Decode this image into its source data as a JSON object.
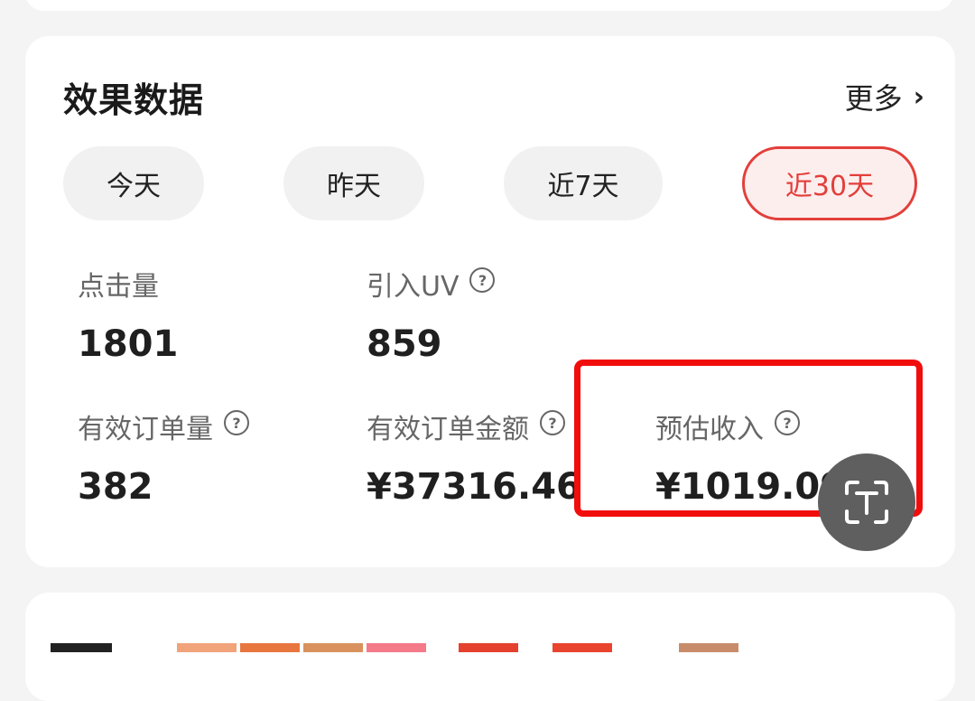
{
  "section": {
    "title": "效果数据",
    "more_label": "更多"
  },
  "tabs": [
    {
      "label": "今天",
      "active": false
    },
    {
      "label": "昨天",
      "active": false
    },
    {
      "label": "近7天",
      "active": false
    },
    {
      "label": "近30天",
      "active": true
    }
  ],
  "metrics": {
    "clicks": {
      "label": "点击量",
      "value": "1801"
    },
    "uv": {
      "label": "引入UV",
      "value": "859"
    },
    "orders": {
      "label": "有效订单量",
      "value": "382"
    },
    "order_amount": {
      "label": "有效订单金额",
      "value": "¥37316.46"
    },
    "income": {
      "label": "预估收入",
      "value": "¥1019.09"
    }
  },
  "colors": {
    "accent": "#e33f3a",
    "highlight_box": "#f20d0d",
    "card_bg": "#ffffff",
    "page_bg": "#f4f4f4"
  },
  "icons": {
    "more": "chevron-right-icon",
    "help": "question-circle-icon",
    "fab": "text-recognition-icon"
  }
}
